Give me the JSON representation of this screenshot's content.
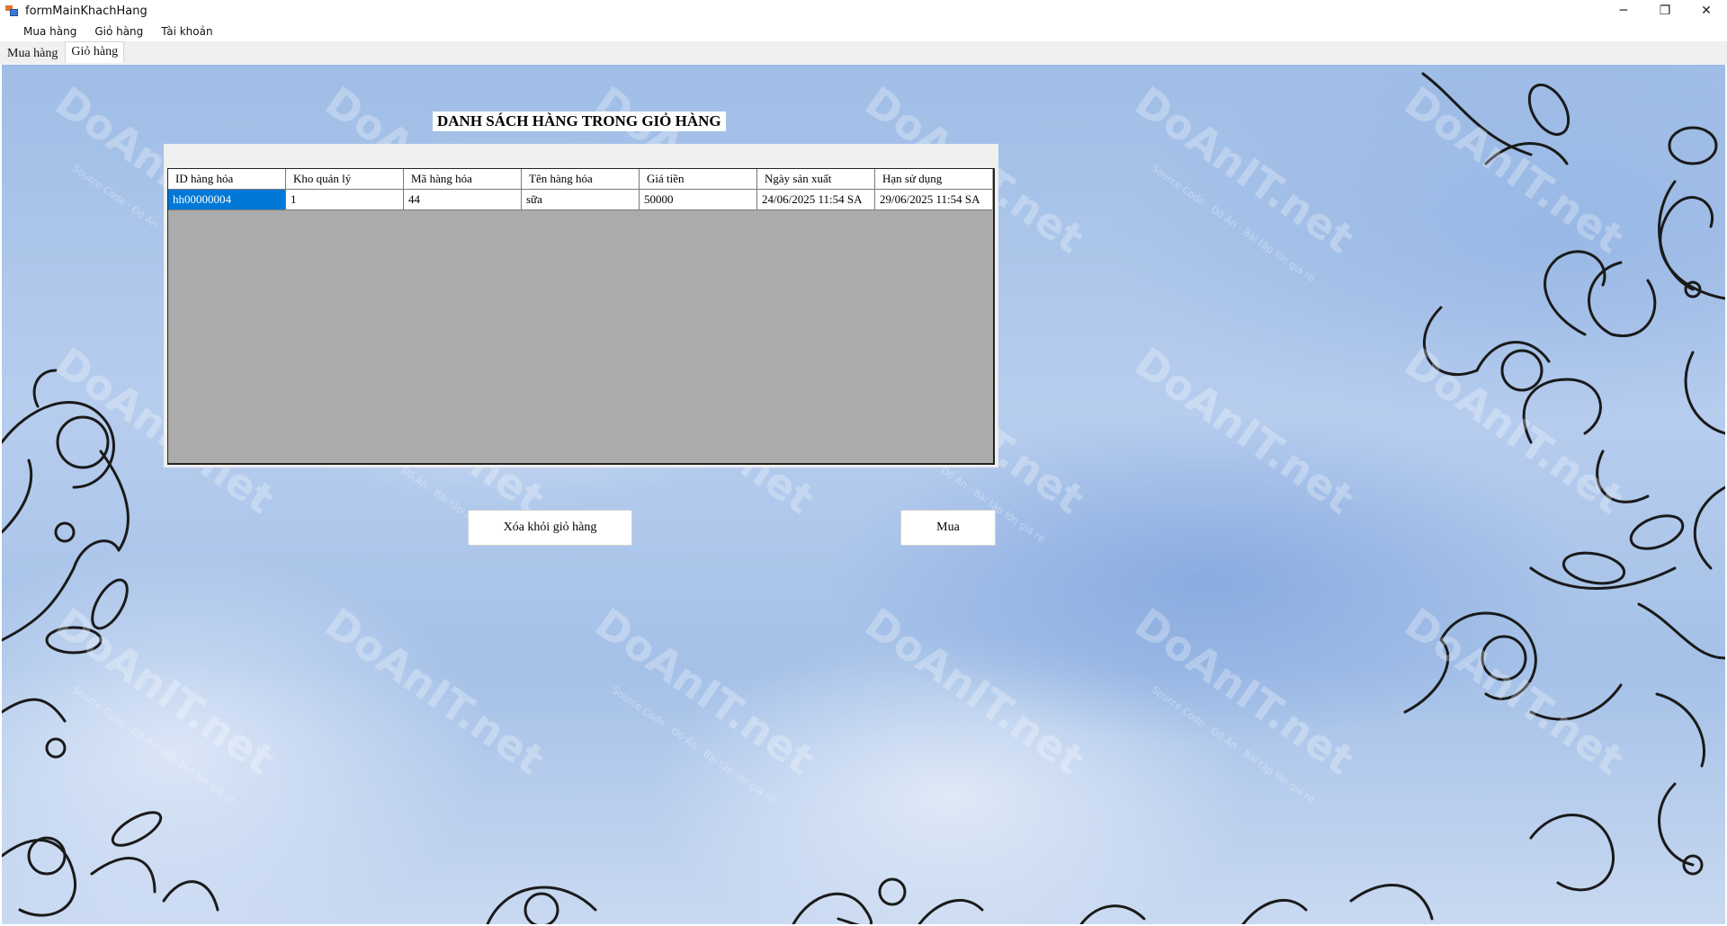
{
  "window": {
    "title": "formMainKhachHang",
    "minimize_glyph": "─",
    "maximize_glyph": "❐",
    "close_glyph": "✕"
  },
  "menu": {
    "items": [
      {
        "label": "Mua hàng"
      },
      {
        "label": "Giỏ hàng"
      },
      {
        "label": "Tài khoản"
      }
    ]
  },
  "tabs": [
    {
      "label": "Mua hàng",
      "active": false
    },
    {
      "label": "Giỏ hàng",
      "active": true
    }
  ],
  "cart": {
    "heading": "DANH SÁCH HÀNG TRONG GIỎ HÀNG",
    "columns": [
      "ID hàng hóa",
      "Kho quản lý",
      "Mã hàng hóa",
      "Tên hàng hóa",
      "Giá tiền",
      "Ngày sản xuất",
      "Hạn sử dụng"
    ],
    "rows": [
      [
        "hh00000004",
        "1",
        "44",
        "sữa",
        "50000",
        "24/06/2025 11:54 SA",
        "29/06/2025 11:54 SA"
      ]
    ],
    "remove_button": "Xóa khỏi giỏ hàng",
    "buy_button": "Mua"
  },
  "watermark": {
    "text": "DoAnIT.net",
    "subtext": "Source Code · Đồ Án · Bài tập lớn giá rẻ"
  },
  "colors": {
    "selection": "#0078d7",
    "grid_background": "#ababab",
    "watermark": "rgba(255,255,255,0.28)"
  },
  "icons": {
    "app": "app-form-icon",
    "minimize": "minimize-icon",
    "maximize": "restore-icon",
    "close": "close-icon"
  }
}
